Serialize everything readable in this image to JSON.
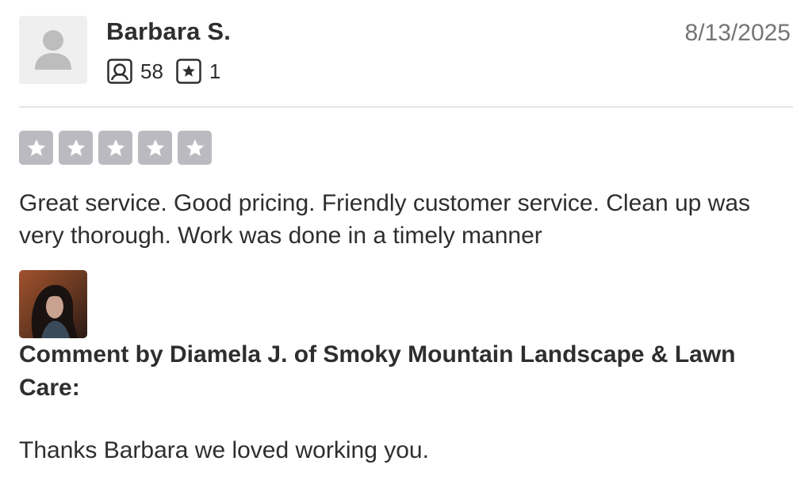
{
  "reviewer": {
    "name": "Barbara S.",
    "avatar_icon": "user-silhouette-icon",
    "stats": {
      "reviews_icon": "review-count-icon",
      "reviews_count": "58",
      "ratings_icon": "star-badge-icon",
      "ratings_count": "1"
    }
  },
  "review": {
    "date": "8/13/2025",
    "rating": 5,
    "rating_max": 5,
    "star_color": "#bbbac0",
    "text": "Great service. Good pricing. Friendly customer service. Clean up was very thorough. Work was done in a timely manner"
  },
  "owner_comment": {
    "photo_icon": "owner-photo",
    "heading": "Comment by Diamela J. of Smoky Mountain Landscape & Lawn Care:",
    "text": "Thanks Barbara we loved working you."
  }
}
